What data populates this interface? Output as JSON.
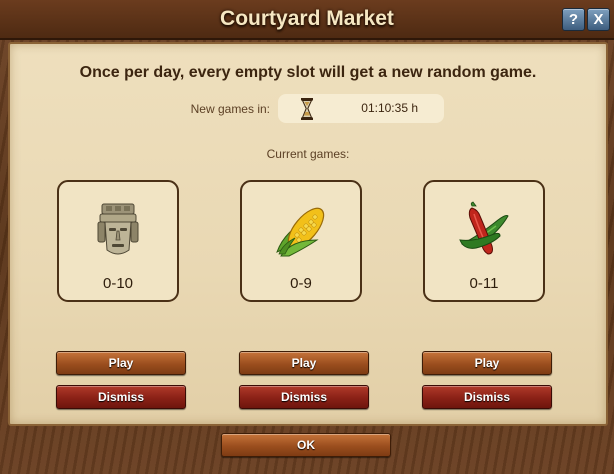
{
  "window": {
    "title": "Courtyard Market",
    "help_label": "?",
    "close_label": "X"
  },
  "main": {
    "headline": "Once per day, every empty slot will get a new random game.",
    "timer_label": "New games in:",
    "timer_value": "01:10:35 h",
    "timer_icon": "hourglass-icon",
    "current_label": "Current games:",
    "games": [
      {
        "icon": "stone-idol-icon",
        "score": "0-10",
        "play_label": "Play",
        "dismiss_label": "Dismiss"
      },
      {
        "icon": "corn-icon",
        "score": "0-9",
        "play_label": "Play",
        "dismiss_label": "Dismiss"
      },
      {
        "icon": "chili-beans-icon",
        "score": "0-11",
        "play_label": "Play",
        "dismiss_label": "Dismiss"
      }
    ]
  },
  "footer": {
    "ok_label": "OK"
  },
  "colors": {
    "frame_wood": "#5a3519",
    "panel_parchment": "#eedfbd",
    "play_button": "#9b4e1e",
    "dismiss_button": "#8a2116",
    "title_text": "#f6e7c2"
  }
}
